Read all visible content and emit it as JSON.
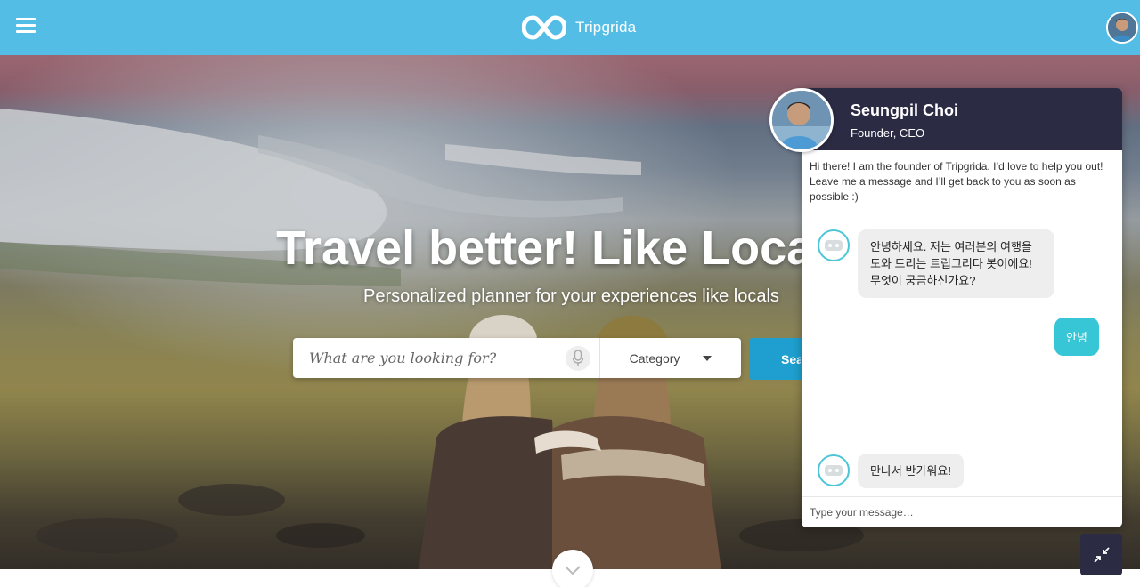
{
  "header": {
    "brand_name": "Tripgrida",
    "menu_icon": "hamburger-menu-icon",
    "logo_icon": "infinity-logo-icon",
    "avatar_icon": "user-avatar",
    "bg_color": "#53bde6"
  },
  "hero": {
    "title": "Travel better! Like Locals",
    "subtitle": "Personalized planner for your experiences like locals",
    "search": {
      "placeholder": "What are you looking for?",
      "mic_icon": "microphone-icon",
      "category_label": "Category",
      "button_label": "Search"
    },
    "scroll_icon": "chevron-down-icon"
  },
  "chat": {
    "name": "Seungpil Choi",
    "role": "Founder, CEO",
    "intro": "Hi there! I am the founder of Tripgrida. I’d love to help you out! Leave me a message and I’ll get back to you as soon as possible :)",
    "messages": [
      {
        "from": "bot",
        "text": "안녕하세요. 저는 여러분의 여행을 도와 드리는 트립그리다 봇이에요! 무엇이 궁금하신가요?"
      },
      {
        "from": "user",
        "text": "안녕"
      },
      {
        "from": "bot",
        "text": "만나서 반가워요!"
      },
      {
        "from": "bot",
        "type": "image"
      }
    ],
    "input_placeholder": "Type your message…",
    "bot_icon": "robot-icon",
    "header_color": "#2b2b44",
    "user_bubble_color": "#36c6d6",
    "minimize_icon": "minimize-arrows-icon"
  }
}
